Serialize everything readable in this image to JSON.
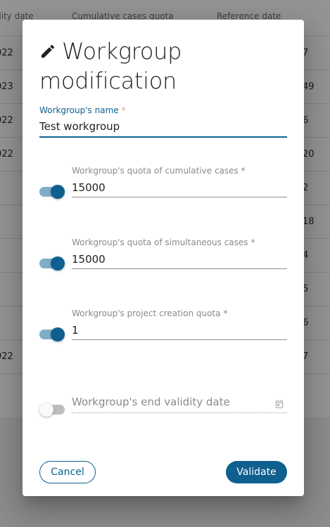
{
  "background": {
    "headers": [
      "dity date",
      "Cumulative cases quota",
      "Reference date"
    ],
    "rows": [
      {
        "left": "022",
        "right": "7"
      },
      {
        "left": "023",
        "right": "49"
      },
      {
        "left": "022",
        "right": "6"
      },
      {
        "left": "022",
        "right": "20"
      },
      {
        "left": "",
        "right": "2"
      },
      {
        "left": "",
        "right": "18"
      },
      {
        "left": "",
        "right": "4"
      },
      {
        "left": "",
        "right": "5"
      },
      {
        "left": "",
        "right": "6"
      },
      {
        "left": "022",
        "right": "7"
      }
    ]
  },
  "dialog": {
    "title_line1": "Workgroup",
    "title_line2": "modification",
    "title_icon": "pencil-icon",
    "name_field": {
      "label": "Workgroup's name",
      "required_mark": "*",
      "value": "Test workgroup"
    },
    "quotas": [
      {
        "label": "Workgroup's quota of cumulative cases",
        "required_mark": "*",
        "value": "15000",
        "enabled": true
      },
      {
        "label": "Workgroup's quota of simultaneous cases",
        "required_mark": "*",
        "value": "15000",
        "enabled": true
      },
      {
        "label": "Workgroup's project creation quota",
        "required_mark": "*",
        "value": "1",
        "enabled": true
      }
    ],
    "end_date": {
      "placeholder": "Workgroup's end validity date",
      "enabled": false,
      "icon": "calendar-icon"
    },
    "cancel_label": "Cancel",
    "validate_label": "Validate"
  },
  "colors": {
    "accent": "#0f5f8f",
    "toggle_track_on": "#7fafc8",
    "overlay": "rgba(0,0,0,0.42)"
  }
}
